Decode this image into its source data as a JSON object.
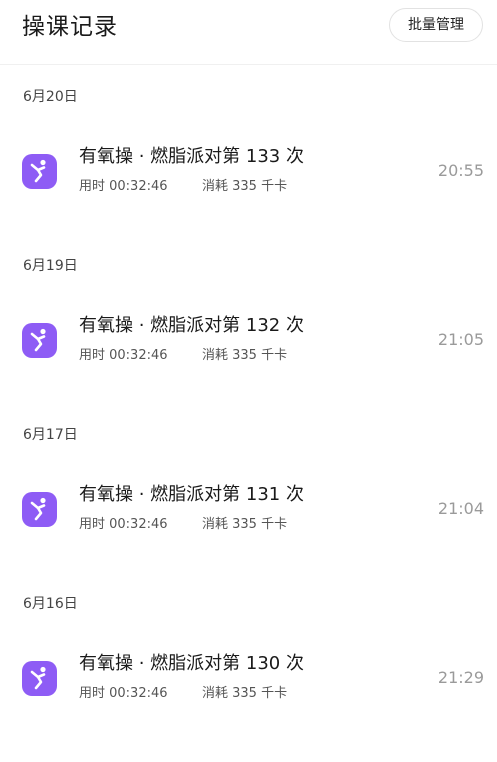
{
  "header": {
    "title": "操课记录",
    "batch_button": "批量管理"
  },
  "colors": {
    "icon_bg": "#8e5cf5",
    "icon_fg": "#ffffff",
    "time_text": "#9a9a9a"
  },
  "groups": [
    {
      "date": "6月20日",
      "record": {
        "icon": "fitness-person-icon",
        "title": "有氧操 · 燃脂派对第 133 次",
        "duration": "用时 00:32:46",
        "calories": "消耗 335 千卡",
        "time": "20:55"
      }
    },
    {
      "date": "6月19日",
      "record": {
        "icon": "fitness-person-icon",
        "title": "有氧操 · 燃脂派对第 132 次",
        "duration": "用时 00:32:46",
        "calories": "消耗 335 千卡",
        "time": "21:05"
      }
    },
    {
      "date": "6月17日",
      "record": {
        "icon": "fitness-person-icon",
        "title": "有氧操 · 燃脂派对第 131 次",
        "duration": "用时 00:32:46",
        "calories": "消耗 335 千卡",
        "time": "21:04"
      }
    },
    {
      "date": "6月16日",
      "record": {
        "icon": "fitness-person-icon",
        "title": "有氧操 · 燃脂派对第 130 次",
        "duration": "用时 00:32:46",
        "calories": "消耗 335 千卡",
        "time": "21:29"
      }
    }
  ]
}
